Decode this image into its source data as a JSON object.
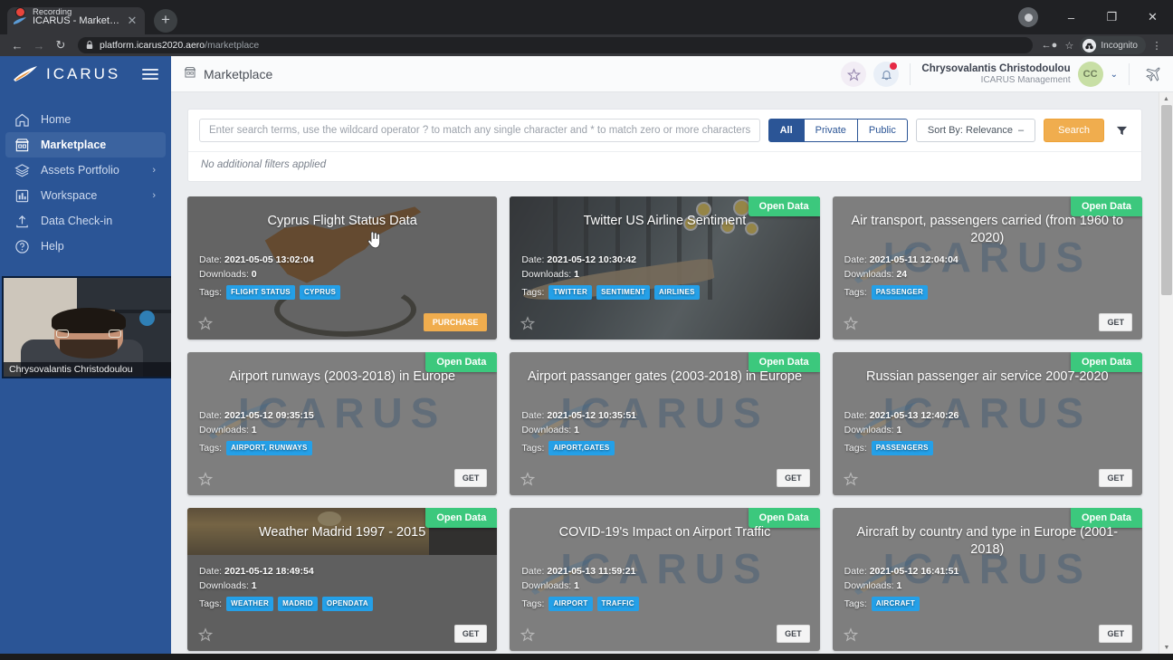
{
  "browser": {
    "tab": {
      "recording_label": "Recording",
      "title": "ICARUS - Marketplace",
      "close_glyph": "✕"
    },
    "new_tab_glyph": "+",
    "window_controls": {
      "minimize": "–",
      "maximize": "❐",
      "close": "✕"
    },
    "nav": {
      "back": "←",
      "forward": "→",
      "reload": "↻"
    },
    "url": {
      "host": "platform.icarus2020.aero",
      "path": "/marketplace"
    },
    "profile_label": "Incognito",
    "menu_glyph": "⋮",
    "star_glyph": "☆",
    "key_glyph": "←●"
  },
  "sidebar": {
    "brand": "ICARUS",
    "items": [
      {
        "label": "Home",
        "icon": "home-icon",
        "active": false,
        "chevron": ""
      },
      {
        "label": "Marketplace",
        "icon": "marketplace-icon",
        "active": true,
        "chevron": ""
      },
      {
        "label": "Assets Portfolio",
        "icon": "layers-icon",
        "active": false,
        "chevron": "›"
      },
      {
        "label": "Workspace",
        "icon": "chart-icon",
        "active": false,
        "chevron": "›"
      },
      {
        "label": "Data Check-in",
        "icon": "upload-icon",
        "active": false,
        "chevron": ""
      },
      {
        "label": "Help",
        "icon": "question-icon",
        "active": false,
        "chevron": ""
      }
    ]
  },
  "webcam": {
    "name": "Chrysovalantis Christodoulou"
  },
  "topbar": {
    "page_title": "Marketplace",
    "favorites_icon": "star-icon",
    "notifications_icon": "bell-icon",
    "user_name": "Chrysovalantis Christodoulou",
    "user_role": "ICARUS Management",
    "avatar_initials": "CC",
    "caret": "⌄",
    "plane_icon": "plane-icon"
  },
  "search": {
    "placeholder": "Enter search terms, use the wildcard operator ? to match any single character and * to match zero or more characters",
    "value": "",
    "scopes": [
      {
        "label": "All",
        "active": true
      },
      {
        "label": "Private",
        "active": false
      },
      {
        "label": "Public",
        "active": false
      }
    ],
    "sort_label": "Sort By: Relevance",
    "sort_caret": "–",
    "search_button": "Search",
    "filter_icon": "funnel-icon",
    "filters_note": "No additional filters applied"
  },
  "labels": {
    "date": "Date:",
    "downloads": "Downloads:",
    "tags": "Tags:",
    "open_data": "Open Data",
    "get": "GET",
    "purchase": "PURCHASE"
  },
  "cards": [
    {
      "title": "Cyprus Flight Status Data",
      "date": "2021-05-05 13:02:04",
      "downloads": "0",
      "tags": [
        "FLIGHT STATUS",
        "CYPRUS"
      ],
      "open_data": false,
      "action": "PURCHASE",
      "theme": "cyprus"
    },
    {
      "title": "Twitter US Airline Sentiment",
      "date": "2021-05-12 10:30:42",
      "downloads": "1",
      "tags": [
        "TWITTER",
        "SENTIMENT",
        "AIRLINES"
      ],
      "open_data": true,
      "action": "",
      "theme": "twitter"
    },
    {
      "title": "Air transport, passengers carried (from 1960 to 2020)",
      "date": "2021-05-11 12:04:04",
      "downloads": "24",
      "tags": [
        "PASSENGER"
      ],
      "open_data": true,
      "action": "GET",
      "theme": "plain"
    },
    {
      "title": "Airport runways (2003-2018) in Europe",
      "date": "2021-05-12 09:35:15",
      "downloads": "1",
      "tags": [
        "AIRPORT, RUNWAYS"
      ],
      "open_data": true,
      "action": "GET",
      "theme": "plain"
    },
    {
      "title": "Airport passanger gates (2003-2018) in Europe",
      "date": "2021-05-12 10:35:51",
      "downloads": "1",
      "tags": [
        "AIPORT,GATES"
      ],
      "open_data": true,
      "action": "GET",
      "theme": "plain"
    },
    {
      "title": "Russian passenger air service 2007-2020",
      "date": "2021-05-13 12:40:26",
      "downloads": "1",
      "tags": [
        "PASSENGERS"
      ],
      "open_data": true,
      "action": "GET",
      "theme": "plain"
    },
    {
      "title": "Weather Madrid 1997 - 2015",
      "date": "2021-05-12 18:49:54",
      "downloads": "1",
      "tags": [
        "WEATHER",
        "MADRID",
        "OPENDATA"
      ],
      "open_data": true,
      "action": "GET",
      "theme": "weather"
    },
    {
      "title": "COVID-19's Impact on Airport Traffic",
      "date": "2021-05-13 11:59:21",
      "downloads": "1",
      "tags": [
        "AIRPORT",
        "TRAFFIC"
      ],
      "open_data": true,
      "action": "GET",
      "theme": "plain"
    },
    {
      "title": "Aircraft by country and type in Europe (2001-2018)",
      "date": "2021-05-12 16:41:51",
      "downloads": "1",
      "tags": [
        "AIRCRAFT"
      ],
      "open_data": true,
      "action": "GET",
      "theme": "plain"
    }
  ],
  "watermark": "ICARUS",
  "colors": {
    "brand_blue": "#2b5596",
    "accent_orange": "#f0ad4e",
    "open_data_green": "#3cc87d",
    "tag_blue": "#24a0e8",
    "card_gray": "#7e7e7e"
  }
}
